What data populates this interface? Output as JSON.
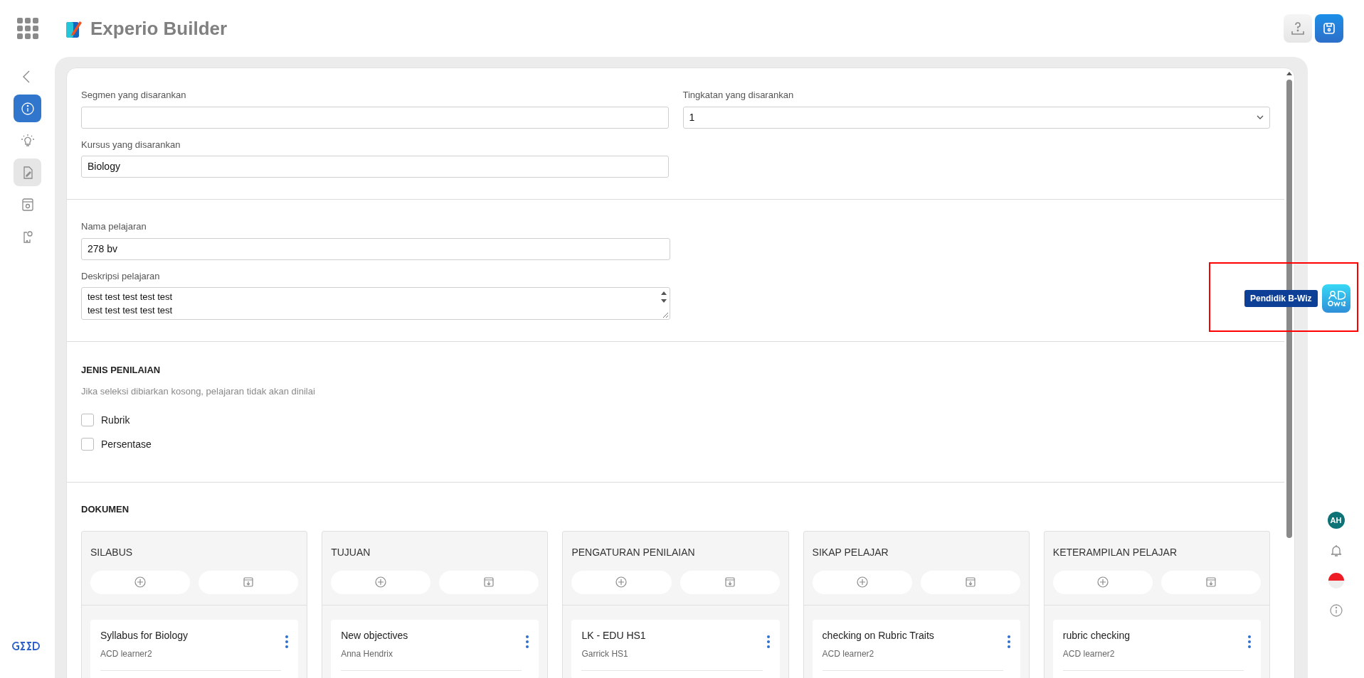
{
  "header": {
    "title": "Experio Builder"
  },
  "sidebar": {
    "items": [
      {
        "selected": false,
        "highlighted": false
      },
      {
        "selected": true,
        "highlighted": false
      },
      {
        "selected": false,
        "highlighted": false
      },
      {
        "selected": false,
        "highlighted": true
      },
      {
        "selected": false,
        "highlighted": false
      },
      {
        "selected": false,
        "highlighted": false
      }
    ]
  },
  "form": {
    "segment": {
      "label": "Segmen yang disarankan"
    },
    "level": {
      "label": "Tingkatan yang disarankan",
      "value": "1"
    },
    "course": {
      "label": "Kursus yang disarankan",
      "value": "Biology"
    },
    "lesson_name": {
      "label": "Nama pelajaran",
      "value": "278 bv"
    },
    "lesson_description": {
      "label": "Deskripsi pelajaran",
      "lines": [
        "test test test test test",
        "test test test test test"
      ]
    }
  },
  "assessment": {
    "title": "JENIS PENILAIAN",
    "hint": "Jika seleksi dibiarkan kosong, pelajaran tidak akan dinilai",
    "options": [
      {
        "label": "Rubrik",
        "checked": false
      },
      {
        "label": "Persentase",
        "checked": false
      }
    ]
  },
  "documents": {
    "title": "DOKUMEN",
    "columns": [
      {
        "title": "SILABUS",
        "items": [
          {
            "title": "Syllabus for Biology",
            "author": "ACD learner2"
          }
        ]
      },
      {
        "title": "TUJUAN",
        "items": [
          {
            "title": "New objectives",
            "author": "Anna Hendrix"
          }
        ]
      },
      {
        "title": "PENGATURAN PENILAIAN",
        "items": [
          {
            "title": "LK - EDU HS1",
            "author": "Garrick HS1"
          }
        ]
      },
      {
        "title": "SIKAP PELAJAR",
        "items": [
          {
            "title": "checking on Rubric Traits",
            "author": "ACD learner2"
          }
        ]
      },
      {
        "title": "KETERAMPILAN PELAJAR",
        "items": [
          {
            "title": "rubric checking",
            "author": "ACD learner2"
          }
        ]
      }
    ]
  },
  "assistant": {
    "label": "Pendidik B-Wiz"
  },
  "user": {
    "initials": "AH"
  }
}
